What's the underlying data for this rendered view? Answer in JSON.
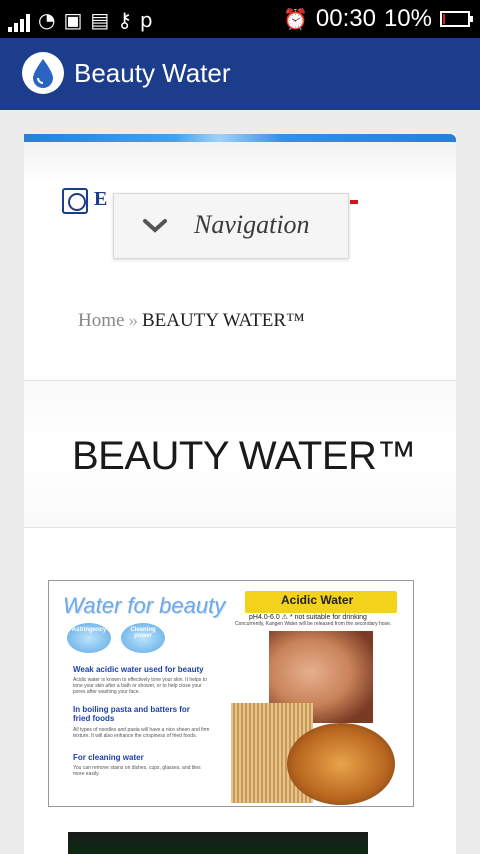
{
  "status_bar": {
    "time": "00:30",
    "battery_percent": "10%",
    "battery_level": 0.1,
    "left_icons": [
      "signal-icon",
      "wifi-icon",
      "image-icon",
      "chat-icon",
      "key-icon",
      "p-icon"
    ],
    "right_icons": [
      "alarm-icon",
      "battery-icon"
    ]
  },
  "app_bar": {
    "title": "Beauty Water",
    "icon": "water-drop-icon",
    "color": "#1c3c8c"
  },
  "site": {
    "logo_text": "E",
    "nav_label": "Navigation"
  },
  "breadcrumb": {
    "home": "Home",
    "separator": "»",
    "current": "BEAUTY WATER™"
  },
  "page": {
    "title": "BEAUTY WATER™"
  },
  "promo": {
    "title": "Water for beauty",
    "acid_title": "Acidic Water",
    "acid_sub": "pH4.0-6.0  ⚠ * not suitable for drinking",
    "acid_note": "Concurrently, Kangen Water will be released from the secondary hose.",
    "bubbles": [
      "Astringency",
      "Cleaning power"
    ],
    "sections": [
      {
        "heading": "Weak acidic water used for beauty",
        "text": "Acidic water is known to effectively tone your skin. It helps to tone your skin after a bath or shower, or to help close your pores after washing your face."
      },
      {
        "heading": "In boiling pasta and batters for fried foods",
        "text": "All types of noodles and pasta will have a nice sheen and firm texture. It will also enhance the crispiness of fried foods."
      },
      {
        "heading": "For cleaning water",
        "text": "You can remove stains on dishes, cups, glasses, and tiles more easily."
      }
    ]
  }
}
